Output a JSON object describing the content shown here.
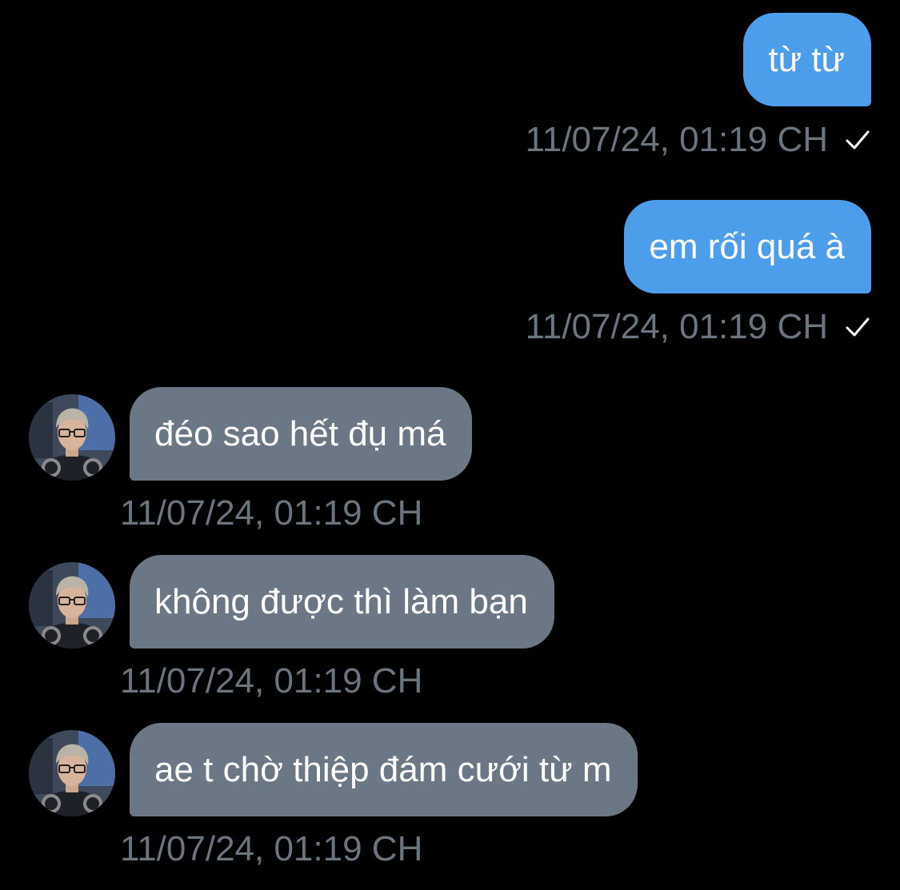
{
  "colors": {
    "background": "#000000",
    "outgoing_bubble": "#4c9eeb",
    "incoming_bubble": "#6c7785",
    "timestamp": "#6b7580"
  },
  "messages": [
    {
      "direction": "outgoing",
      "text": "từ từ",
      "timestamp": "11/07/24, 01:19 CH",
      "status_icon": "check-icon"
    },
    {
      "direction": "outgoing",
      "text": "em rối quá à",
      "timestamp": "11/07/24, 01:19 CH",
      "status_icon": "check-icon"
    },
    {
      "direction": "incoming",
      "text": "đéo sao hết đụ má",
      "timestamp": "11/07/24, 01:19 CH",
      "avatar": "avatar"
    },
    {
      "direction": "incoming",
      "text": "không được thì làm bạn",
      "timestamp": "11/07/24, 01:19 CH",
      "avatar": "avatar"
    },
    {
      "direction": "incoming",
      "text": "ae t chờ thiệp đám cưới từ m",
      "timestamp": "11/07/24, 01:19 CH",
      "avatar": "avatar"
    }
  ]
}
